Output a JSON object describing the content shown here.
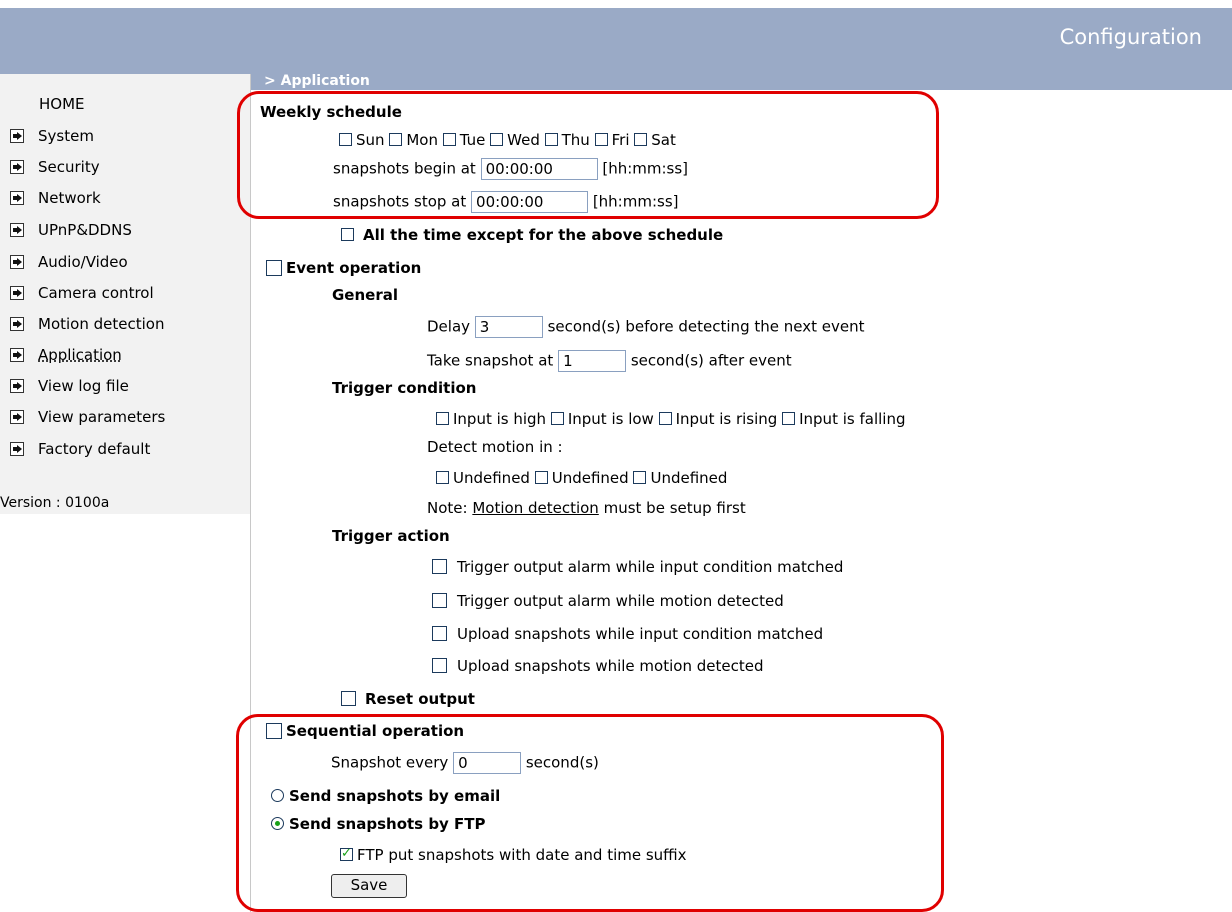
{
  "header": {
    "title": "Configuration",
    "breadcrumb": "> Application"
  },
  "sidebar": {
    "home": "HOME",
    "items": [
      {
        "label": "System"
      },
      {
        "label": "Security"
      },
      {
        "label": "Network"
      },
      {
        "label": "UPnP&DDNS"
      },
      {
        "label": "Audio/Video"
      },
      {
        "label": "Camera control"
      },
      {
        "label": "Motion detection"
      },
      {
        "label": "Application"
      },
      {
        "label": "View log file"
      },
      {
        "label": "View parameters"
      },
      {
        "label": "Factory default"
      }
    ],
    "version": "Version : 0100a"
  },
  "weekly": {
    "title": "Weekly schedule",
    "days": [
      "Sun",
      "Mon",
      "Tue",
      "Wed",
      "Thu",
      "Fri",
      "Sat"
    ],
    "begin_label": "snapshots begin at",
    "begin_value": "00:00:00",
    "stop_label": "snapshots stop at",
    "stop_value": "00:00:00",
    "format": "[hh:mm:ss]",
    "except_label": "All the time except for the above schedule"
  },
  "event": {
    "title": "Event operation",
    "general": "General",
    "delay_label": "Delay",
    "delay_value": "3",
    "delay_suffix": "second(s) before detecting the next event",
    "snap_label": "Take snapshot at",
    "snap_value": "1",
    "snap_suffix": "second(s) after event",
    "trigger_condition": "Trigger condition",
    "inputs": [
      "Input is high",
      "Input is low",
      "Input is rising",
      "Input is falling"
    ],
    "detect_label": "Detect motion in :",
    "windows": [
      "Undefined",
      "Undefined",
      "Undefined"
    ],
    "note_prefix": "Note:",
    "note_link": "Motion detection",
    "note_suffix": "must be setup first",
    "trigger_action": "Trigger action",
    "actions": [
      "Trigger output alarm while input condition matched",
      "Trigger output alarm while motion detected",
      "Upload snapshots while input condition matched",
      "Upload snapshots while motion detected"
    ],
    "reset_output": "Reset output"
  },
  "sequential": {
    "title": "Sequential operation",
    "every_label": "Snapshot every",
    "every_value": "0",
    "every_suffix": "second(s)",
    "email_label": "Send snapshots by email",
    "ftp_label": "Send snapshots by FTP",
    "ftp_suffix_label": "FTP put snapshots with date and time suffix",
    "save": "Save"
  }
}
